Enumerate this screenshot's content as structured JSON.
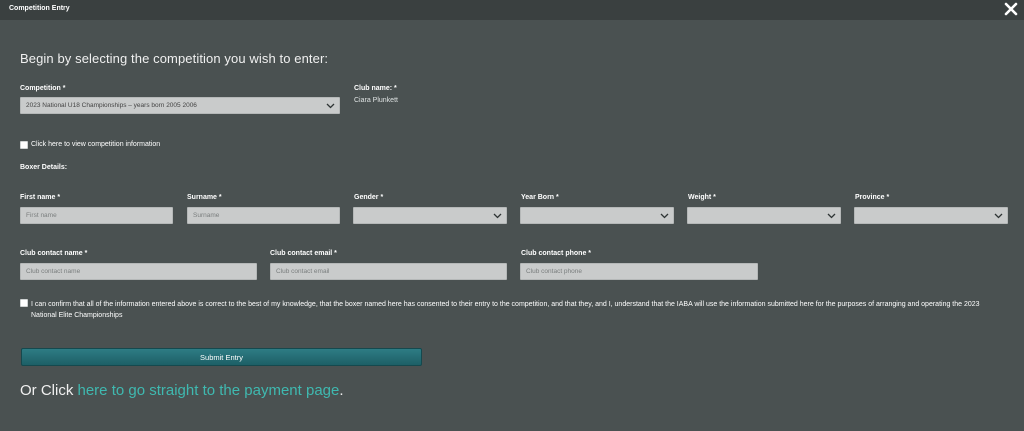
{
  "window": {
    "title": "Competition Entry",
    "close_icon": "close-icon"
  },
  "heading": "Begin by selecting the competition you wish to enter:",
  "competition": {
    "label": "Competition *",
    "selected": "2023 National U18 Championships – years born 2005 2006"
  },
  "club": {
    "label": "Club name: *",
    "value": "Ciara Plunkett"
  },
  "info_checkbox": {
    "label": "Click here to view competition information",
    "checked": false
  },
  "boxer_details_label": "Boxer Details:",
  "boxer": {
    "first_name": {
      "label": "First name *",
      "placeholder": "First name",
      "value": ""
    },
    "surname": {
      "label": "Surname *",
      "placeholder": "Surname",
      "value": ""
    },
    "gender": {
      "label": "Gender *",
      "selected": ""
    },
    "year_born": {
      "label": "Year Born *",
      "selected": ""
    },
    "weight": {
      "label": "Weight *",
      "selected": ""
    },
    "province": {
      "label": "Province *",
      "selected": ""
    }
  },
  "contact": {
    "name": {
      "label": "Club contact name *",
      "placeholder": "Club contact name",
      "value": ""
    },
    "email": {
      "label": "Club contact email *",
      "placeholder": "Club contact email",
      "value": ""
    },
    "phone": {
      "label": "Club contact phone *",
      "placeholder": "Club contact phone",
      "value": ""
    }
  },
  "consent": {
    "checked": false,
    "text": "I can confirm that all of the information entered above is correct to the best of my knowledge, that the boxer named here has consented to their entry to the competition, and that they, and I, understand that the IABA will use the information submitted here for the purposes of arranging and operating the 2023 National Elite Championships"
  },
  "submit_label": "Submit Entry",
  "payment": {
    "prefix": "Or Click ",
    "link": "here to go straight to the payment page",
    "suffix": "."
  },
  "colors": {
    "background": "#4a5151",
    "titlebar": "#3a4040",
    "field": "#c9cbcb",
    "button": "#1d5f66",
    "link": "#3fb9b0"
  }
}
